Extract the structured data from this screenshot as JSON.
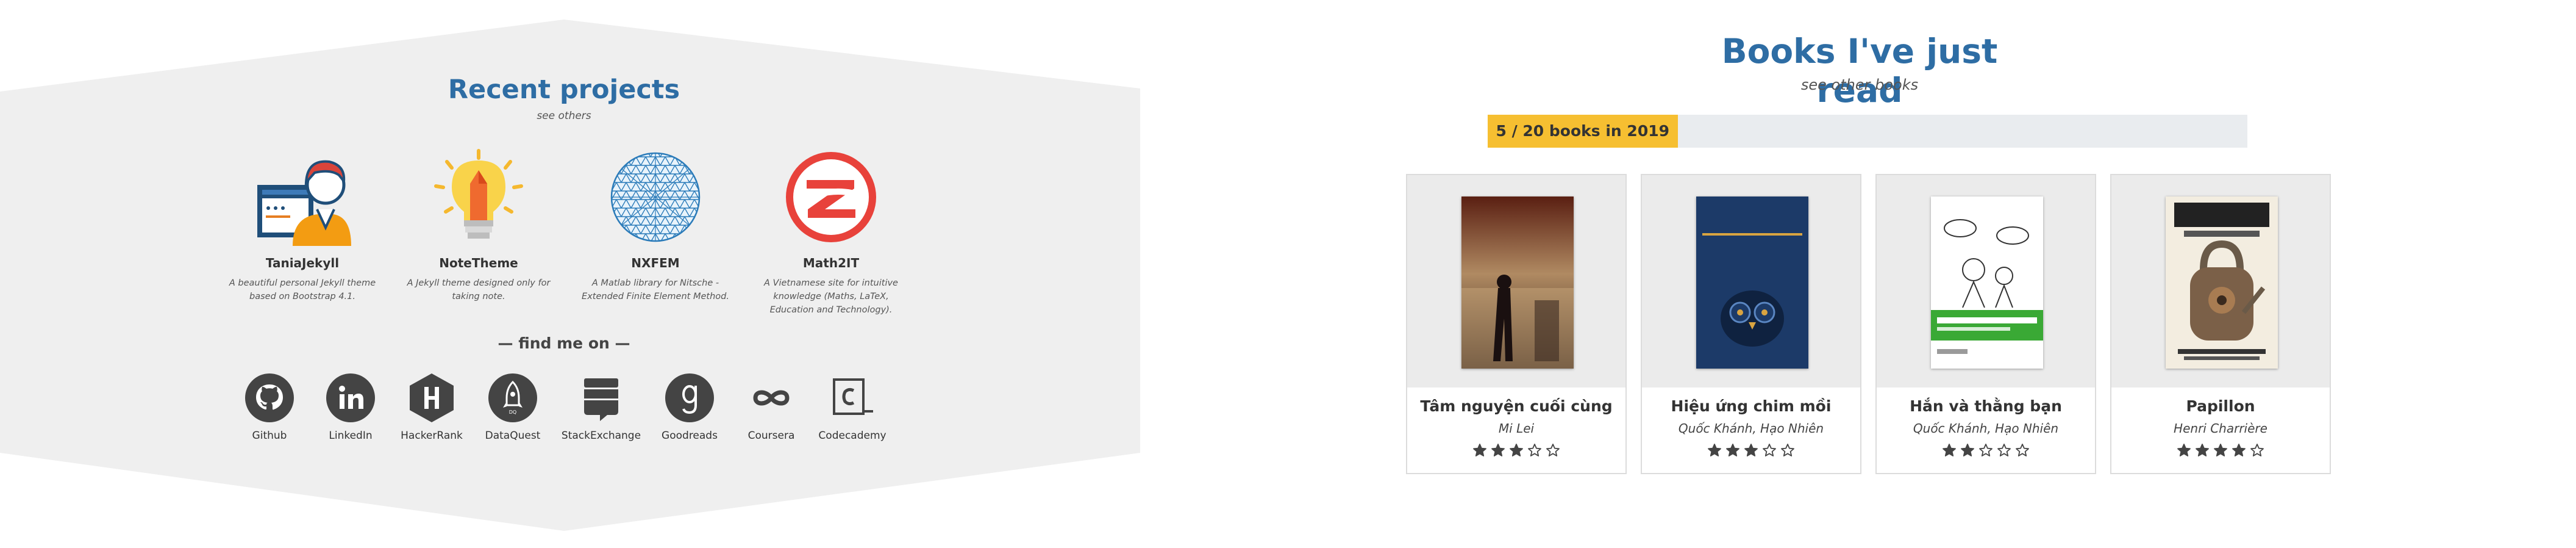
{
  "projects": {
    "title": "Recent projects",
    "see_others": "see others",
    "items": [
      {
        "name": "TaniaJekyll",
        "desc": "A beautiful personal Jekyll theme based on Bootstrap 4.1.",
        "icon": "developer-avatar-icon"
      },
      {
        "name": "NoteTheme",
        "desc": "A Jekyll theme designed only for taking note.",
        "icon": "lightbulb-icon"
      },
      {
        "name": "NXFEM",
        "desc": "A Matlab library for Nitsche - Extended Finite Element Method.",
        "icon": "mesh-sphere-icon"
      },
      {
        "name": "Math2IT",
        "desc": "A Vietnamese site for intuitive knowledge (Maths, LaTeX, Education and Technology).",
        "icon": "math2it-logo-icon"
      }
    ]
  },
  "find_me": {
    "label": "— find me on —",
    "links": [
      {
        "label": "Github",
        "icon": "github-icon"
      },
      {
        "label": "LinkedIn",
        "icon": "linkedin-icon"
      },
      {
        "label": "HackerRank",
        "icon": "hackerrank-icon"
      },
      {
        "label": "DataQuest",
        "icon": "dataquest-icon"
      },
      {
        "label": "StackExchange",
        "icon": "stackexchange-icon"
      },
      {
        "label": "Goodreads",
        "icon": "goodreads-icon"
      },
      {
        "label": "Coursera",
        "icon": "coursera-icon"
      },
      {
        "label": "Codecademy",
        "icon": "codecademy-icon"
      }
    ]
  },
  "books": {
    "title": "Books I've just read",
    "see_other": "see other books",
    "progress": {
      "label": "5 / 20 books in 2019",
      "read": 5,
      "goal": 20,
      "color": "#f6bf31"
    },
    "items": [
      {
        "title": "Tâm nguyện cuối cùng",
        "author": "Mi Lei",
        "rating": 3
      },
      {
        "title": "Hiệu ứng chim mồi",
        "author": "Quốc Khánh, Hạo Nhiên",
        "rating": 3
      },
      {
        "title": "Hắn và thằng bạn",
        "author": "Quốc Khánh, Hạo Nhiên",
        "rating": 2
      },
      {
        "title": "Papillon",
        "author": "Henri Charrière",
        "rating": 4
      }
    ]
  },
  "colors": {
    "accent": "#2e6da4",
    "progress": "#f6bf31",
    "panel_bg": "#efefef"
  }
}
